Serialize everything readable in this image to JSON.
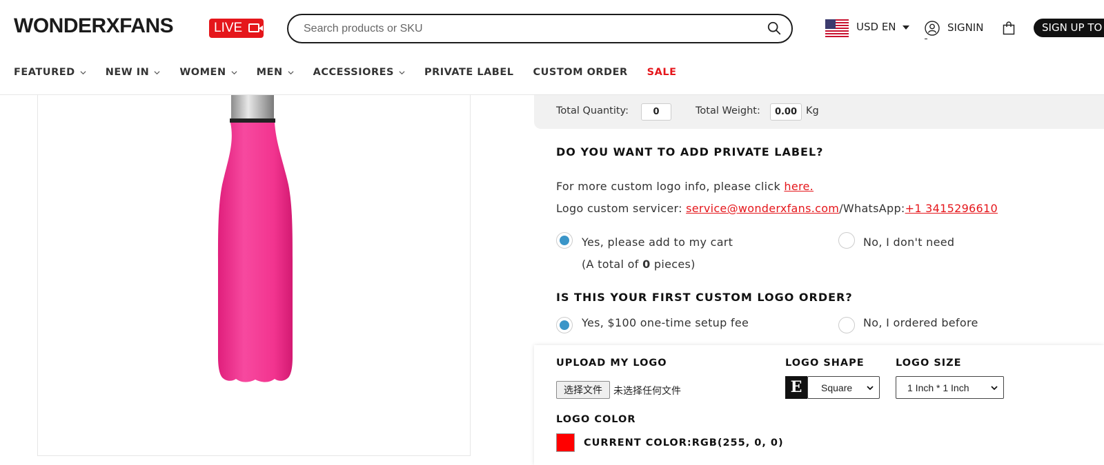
{
  "header": {
    "logo_text": "WONDERXFANS",
    "live_label": "LIVE",
    "search_placeholder": "Search products or SKU",
    "currency_label": "USD EN",
    "signin_label": "SIGNIN",
    "signup_label": "SIGN UP TO"
  },
  "nav": {
    "items": [
      {
        "label": "FEATURED"
      },
      {
        "label": "NEW IN"
      },
      {
        "label": "WOMEN"
      },
      {
        "label": "MEN"
      },
      {
        "label": "ACCESSIORES"
      },
      {
        "label": "PRIVATE LABEL"
      },
      {
        "label": "CUSTOM ORDER"
      },
      {
        "label": "SALE"
      }
    ]
  },
  "totals": {
    "quantity_label": "Total Quantity:",
    "quantity_value": "0",
    "weight_label": "Total Weight:",
    "weight_value": "0.00",
    "weight_unit": "Kg"
  },
  "private_label": {
    "heading": "DO YOU WANT TO ADD PRIVATE LABEL?",
    "info_text": "For more custom logo info, please click ",
    "info_link": "here.",
    "servicer_text": "Logo custom servicer: ",
    "servicer_email": "service@wonderxfans.com",
    "whatsapp_text": "/WhatsApp:",
    "whatsapp_number": "+1 3415296610",
    "option_yes": "Yes, please add to my cart",
    "option_no": "No, I don't need",
    "total_prefix": "(A total of ",
    "total_count": "0",
    "total_suffix": " pieces)"
  },
  "first_order": {
    "heading": "IS THIS YOUR FIRST CUSTOM LOGO ORDER?",
    "option_yes": "Yes, $100 one-time setup fee",
    "option_no": "No, I ordered before"
  },
  "logo_options": {
    "upload_heading": "UPLOAD MY LOGO",
    "file_button": "选择文件",
    "file_status": "未选择任何文件",
    "shape_heading": "LOGO SHAPE",
    "shape_thumb": "E",
    "shape_value": "Square",
    "size_heading": "LOGO SIZE",
    "size_value": "1 Inch * 1 Inch",
    "color_heading": "LOGO COLOR",
    "current_color_label": "CURRENT COLOR:RGB(255, 0, 0)",
    "current_color_hex": "#ff0000"
  },
  "colors": {
    "accent_red": "#e5161b",
    "radio_blue": "#3a95c8",
    "bottle_pink": "#f2348f"
  }
}
